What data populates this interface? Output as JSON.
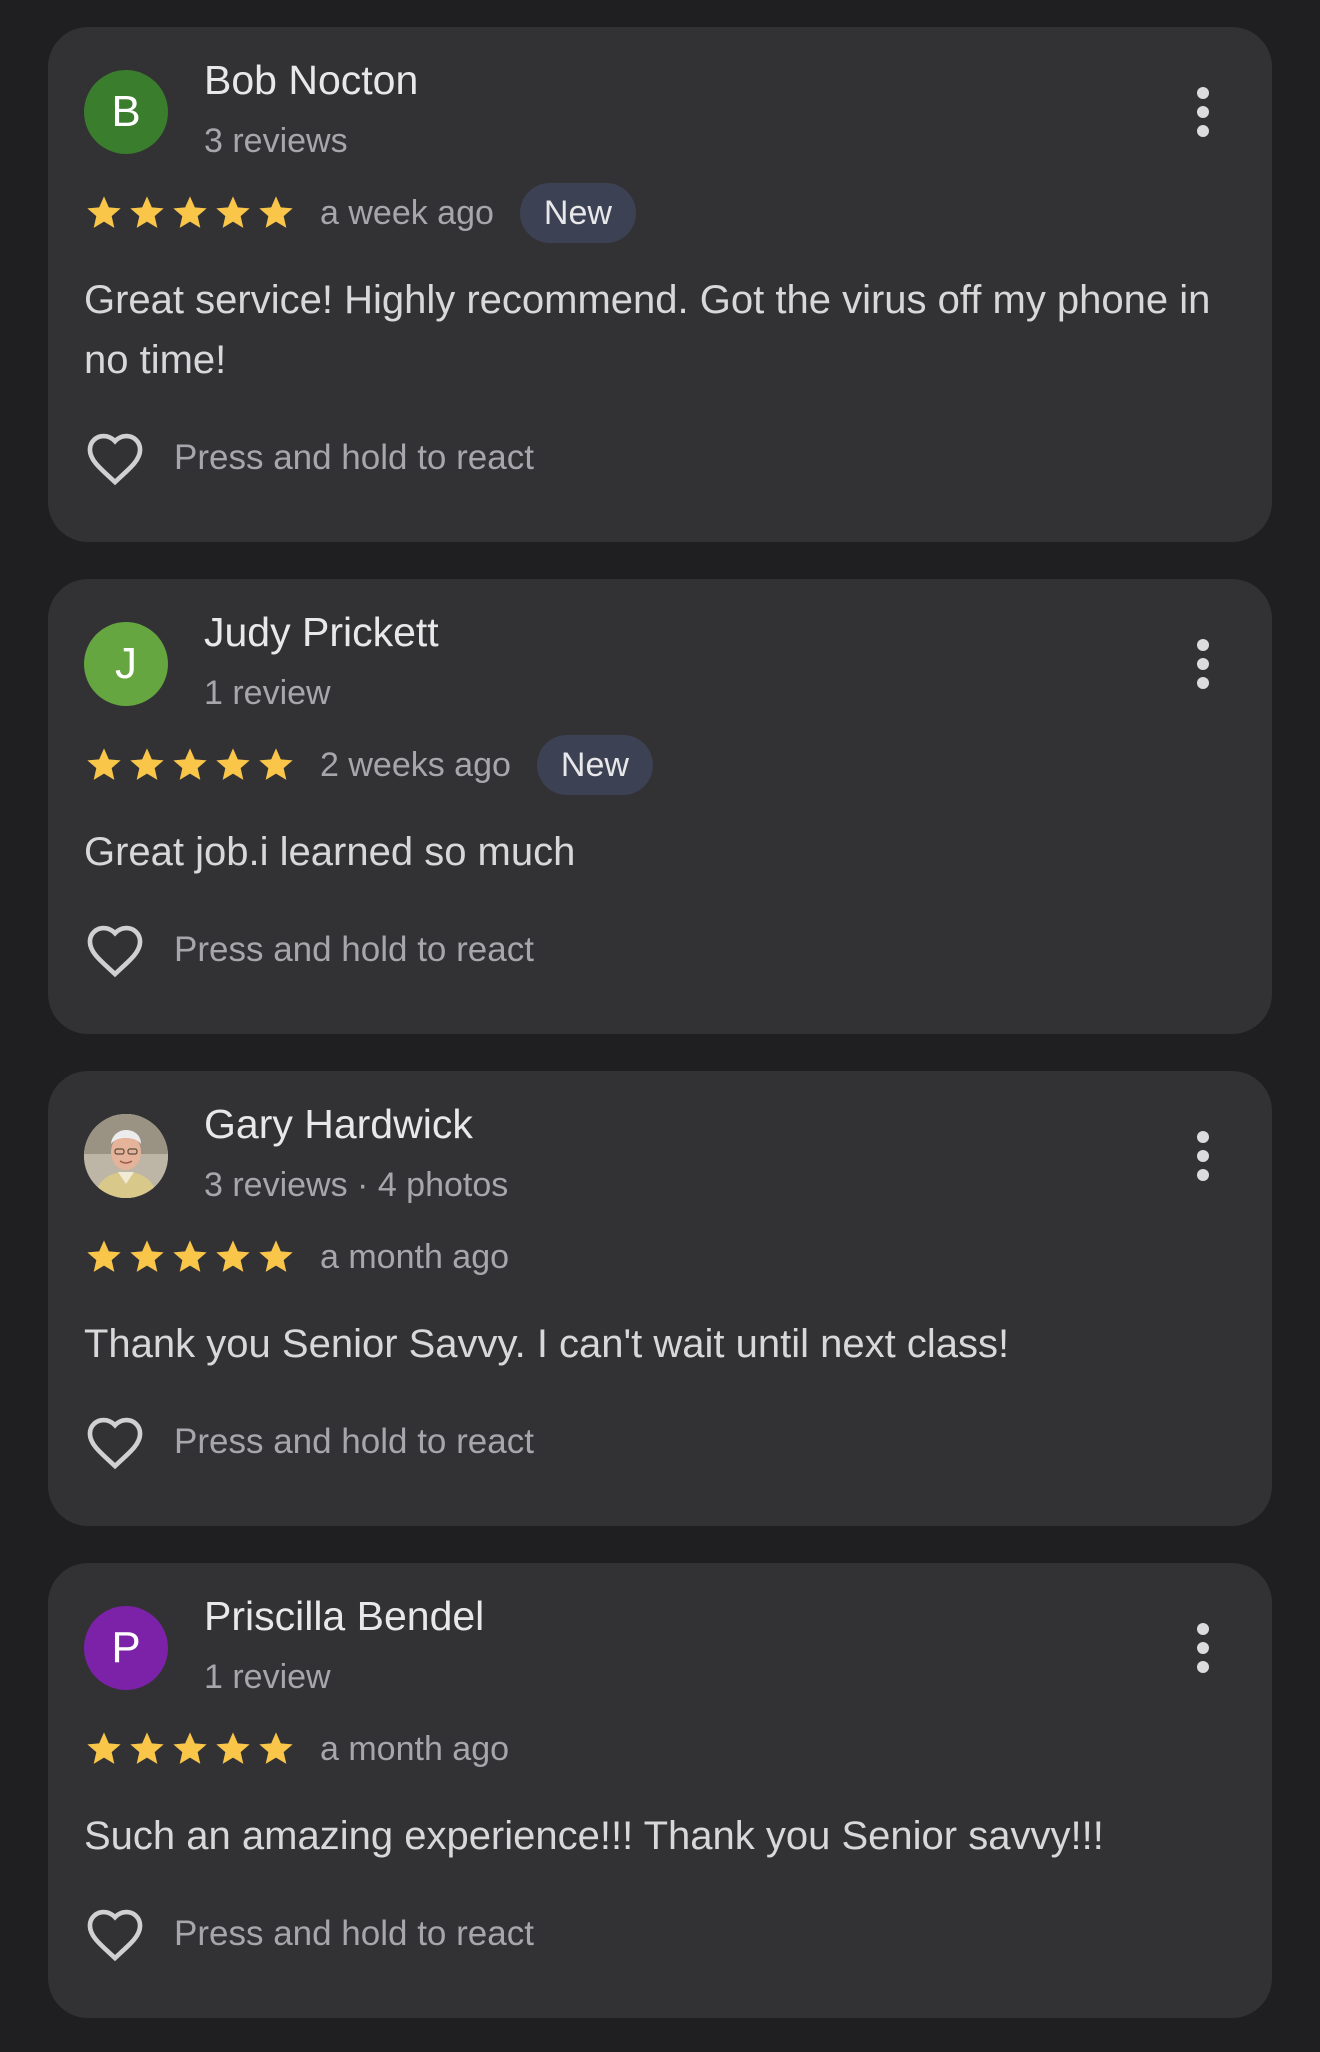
{
  "reviews": [
    {
      "initial": "B",
      "avatar_color": "#3a7d2c",
      "name": "Bob Nocton",
      "meta": "3 reviews",
      "stars": 5,
      "date": "a week ago",
      "badge": "New",
      "text": "Great service! Highly recommend. Got the virus off my phone in no time!",
      "react_label": "Press and hold to react"
    },
    {
      "initial": "J",
      "avatar_color": "#66a640",
      "name": "Judy Prickett",
      "meta": "1 review",
      "stars": 5,
      "date": "2 weeks ago",
      "badge": "New",
      "text": "Great job.i learned so much",
      "react_label": "Press and hold to react"
    },
    {
      "initial": "",
      "avatar_color": "#c9c2b4",
      "name": "Gary Hardwick",
      "meta": "3 reviews · 4 photos",
      "stars": 5,
      "date": "a month ago",
      "text": "Thank you Senior Savvy. I can't wait until next class!",
      "react_label": "Press and hold to react"
    },
    {
      "initial": "P",
      "avatar_color": "#7b22a8",
      "name": "Priscilla Bendel",
      "meta": "1 review",
      "stars": 5,
      "date": "a month ago",
      "text": "Such an amazing experience!!! Thank you Senior savvy!!!",
      "react_label": "Press and hold to react"
    }
  ],
  "colors": {
    "star": "#f9c64a",
    "badge_bg": "#3c4254"
  },
  "icons": {
    "star": "star-icon",
    "more": "more-vert-icon",
    "react": "heart-outline-icon"
  }
}
